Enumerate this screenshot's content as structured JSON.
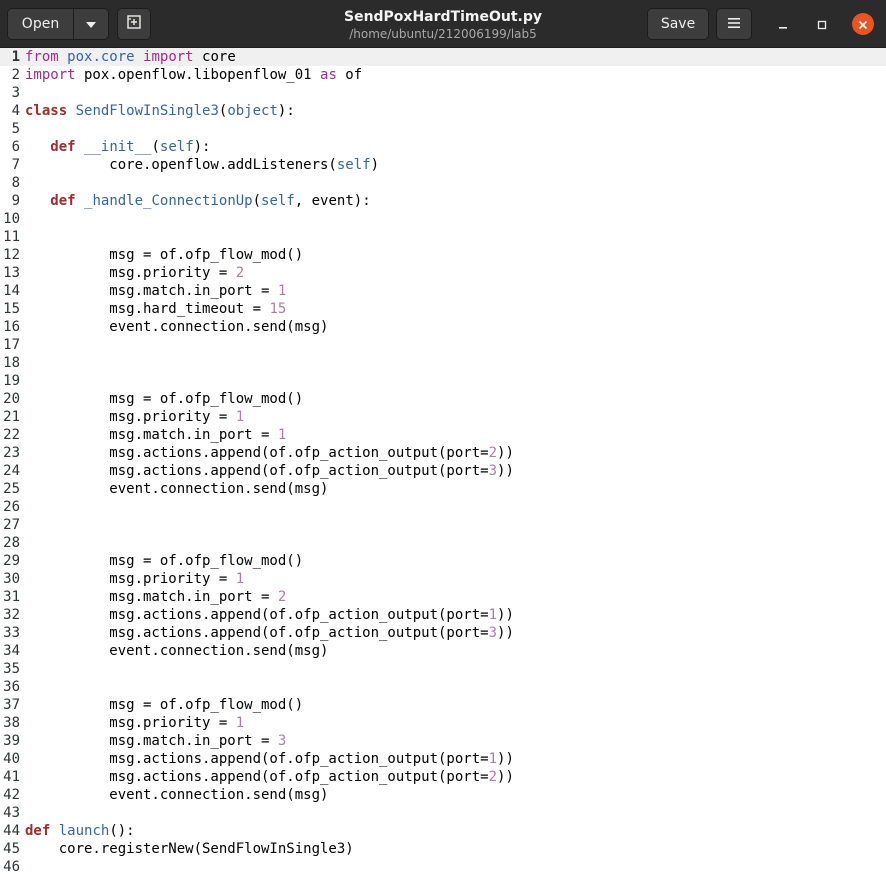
{
  "header": {
    "open_label": "Open",
    "title": "SendPoxHardTimeOut.py",
    "path": "/home/ubuntu/212006199/lab5",
    "save_label": "Save",
    "accent_close": "#e95420"
  },
  "editor": {
    "current_line": 1,
    "lines": [
      [
        [
          "imp",
          "from"
        ],
        [
          "p",
          " "
        ],
        [
          "mod",
          "pox.core"
        ],
        [
          "p",
          " "
        ],
        [
          "imp",
          "import"
        ],
        [
          "p",
          " core"
        ]
      ],
      [
        [
          "imp",
          "import"
        ],
        [
          "p",
          " pox.openflow.libopenflow_01 "
        ],
        [
          "imp",
          "as"
        ],
        [
          "p",
          " of"
        ]
      ],
      [],
      [
        [
          "kw",
          "class"
        ],
        [
          "p",
          " "
        ],
        [
          "fn",
          "SendFlowInSingle3"
        ],
        [
          "p",
          "("
        ],
        [
          "self",
          "object"
        ],
        [
          "p",
          "):"
        ]
      ],
      [],
      [
        [
          "p",
          "   "
        ],
        [
          "kw",
          "def"
        ],
        [
          "p",
          " "
        ],
        [
          "fn",
          "__init__"
        ],
        [
          "p",
          "("
        ],
        [
          "self",
          "self"
        ],
        [
          "p",
          "):"
        ]
      ],
      [
        [
          "p",
          "          core.openflow.addListeners("
        ],
        [
          "self",
          "self"
        ],
        [
          "p",
          ")"
        ]
      ],
      [],
      [
        [
          "p",
          "   "
        ],
        [
          "kw",
          "def"
        ],
        [
          "p",
          " "
        ],
        [
          "fn",
          "_handle_ConnectionUp"
        ],
        [
          "p",
          "("
        ],
        [
          "self",
          "self"
        ],
        [
          "p",
          ", event):"
        ]
      ],
      [],
      [],
      [
        [
          "p",
          "          msg = of.ofp_flow_mod()"
        ]
      ],
      [
        [
          "p",
          "          msg.priority = "
        ],
        [
          "num",
          "2"
        ]
      ],
      [
        [
          "p",
          "          msg.match.in_port = "
        ],
        [
          "num",
          "1"
        ]
      ],
      [
        [
          "p",
          "          msg.hard_timeout = "
        ],
        [
          "num",
          "15"
        ]
      ],
      [
        [
          "p",
          "          event.connection.send(msg)"
        ]
      ],
      [],
      [],
      [],
      [
        [
          "p",
          "          msg = of.ofp_flow_mod()"
        ]
      ],
      [
        [
          "p",
          "          msg.priority = "
        ],
        [
          "num",
          "1"
        ]
      ],
      [
        [
          "p",
          "          msg.match.in_port = "
        ],
        [
          "num",
          "1"
        ]
      ],
      [
        [
          "p",
          "          msg.actions.append(of.ofp_action_output(port="
        ],
        [
          "num",
          "2"
        ],
        [
          "p",
          "))"
        ]
      ],
      [
        [
          "p",
          "          msg.actions.append(of.ofp_action_output(port="
        ],
        [
          "num",
          "3"
        ],
        [
          "p",
          "))"
        ]
      ],
      [
        [
          "p",
          "          event.connection.send(msg)"
        ]
      ],
      [],
      [],
      [],
      [
        [
          "p",
          "          msg = of.ofp_flow_mod()"
        ]
      ],
      [
        [
          "p",
          "          msg.priority = "
        ],
        [
          "num",
          "1"
        ]
      ],
      [
        [
          "p",
          "          msg.match.in_port = "
        ],
        [
          "num",
          "2"
        ]
      ],
      [
        [
          "p",
          "          msg.actions.append(of.ofp_action_output(port="
        ],
        [
          "num",
          "1"
        ],
        [
          "p",
          "))"
        ]
      ],
      [
        [
          "p",
          "          msg.actions.append(of.ofp_action_output(port="
        ],
        [
          "num",
          "3"
        ],
        [
          "p",
          "))"
        ]
      ],
      [
        [
          "p",
          "          event.connection.send(msg)"
        ]
      ],
      [],
      [],
      [
        [
          "p",
          "          msg = of.ofp_flow_mod()"
        ]
      ],
      [
        [
          "p",
          "          msg.priority = "
        ],
        [
          "num",
          "1"
        ]
      ],
      [
        [
          "p",
          "          msg.match.in_port = "
        ],
        [
          "num",
          "3"
        ]
      ],
      [
        [
          "p",
          "          msg.actions.append(of.ofp_action_output(port="
        ],
        [
          "num",
          "1"
        ],
        [
          "p",
          "))"
        ]
      ],
      [
        [
          "p",
          "          msg.actions.append(of.ofp_action_output(port="
        ],
        [
          "num",
          "2"
        ],
        [
          "p",
          "))"
        ]
      ],
      [
        [
          "p",
          "          event.connection.send(msg)"
        ]
      ],
      [],
      [
        [
          "kw",
          "def"
        ],
        [
          "p",
          " "
        ],
        [
          "fn",
          "launch"
        ],
        [
          "p",
          "():"
        ]
      ],
      [
        [
          "p",
          "    core.registerNew(SendFlowInSingle3)"
        ]
      ],
      []
    ]
  }
}
